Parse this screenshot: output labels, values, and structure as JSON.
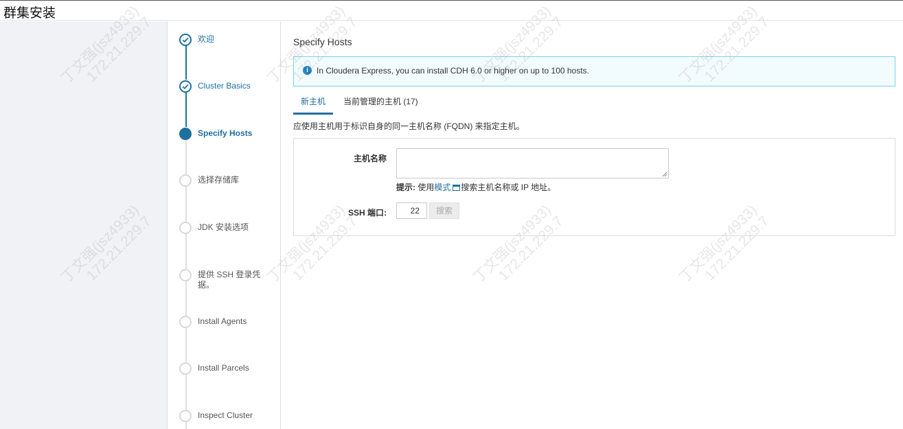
{
  "window": {
    "title": "群集安装"
  },
  "steps": [
    {
      "label": "欢迎",
      "state": "done"
    },
    {
      "label": "Cluster Basics",
      "state": "done"
    },
    {
      "label": "Specify Hosts",
      "state": "active"
    },
    {
      "label": "选择存储库",
      "state": "pending"
    },
    {
      "label": "JDK 安装选项",
      "state": "pending"
    },
    {
      "label": "提供 SSH 登录凭据。",
      "state": "pending"
    },
    {
      "label": "Install Agents",
      "state": "pending"
    },
    {
      "label": "Install Parcels",
      "state": "pending"
    },
    {
      "label": "Inspect Cluster",
      "state": "pending"
    }
  ],
  "main": {
    "title": "Specify Hosts",
    "alert": {
      "icon": "info-icon",
      "text": "In Cloudera Express, you can install CDH 6.0 or higher on up to 100 hosts."
    },
    "tabs": [
      {
        "label": "新主机",
        "active": true
      },
      {
        "label": "当前管理的主机 (17)",
        "active": false
      }
    ],
    "description": "应使用主机用于标识自身的同一主机名称 (FQDN) 来指定主机。",
    "form": {
      "hostname_label": "主机名称",
      "hostname_value": "",
      "hint_prefix": "提示:",
      "hint_use": " 使用",
      "hint_link": "模式",
      "hint_suffix": "搜索主机名称或 IP 地址。",
      "ssh_port_label": "SSH 端口:",
      "ssh_port_value": "22",
      "search_button": "搜索"
    }
  },
  "watermark": {
    "line1": "丁文强(jsz4933)",
    "line2": "172.21.229.7"
  },
  "colors": {
    "accent": "#1f6f9f",
    "alert_border": "#7fd3e8",
    "alert_bg": "#f2fbfd"
  }
}
